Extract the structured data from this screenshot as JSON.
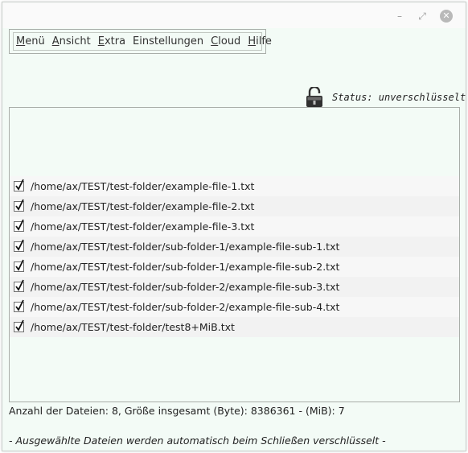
{
  "window": {
    "minimize_icon": "minimize-icon",
    "maximize_icon": "maximize-icon",
    "close_icon": "close-icon"
  },
  "menu": {
    "items": [
      {
        "mnemonic": "M",
        "rest": "enü"
      },
      {
        "mnemonic": "A",
        "rest": "nsicht"
      },
      {
        "mnemonic": "E",
        "rest": "xtra"
      },
      {
        "mnemonic": "",
        "rest": "Einstellungen"
      },
      {
        "mnemonic": "C",
        "rest": "loud"
      },
      {
        "mnemonic": "H",
        "rest": "ilfe"
      }
    ]
  },
  "status": {
    "icon": "unlocked-padlock-icon",
    "text": "Status: unverschlüsselt"
  },
  "files": [
    {
      "checked": true,
      "path": "/home/ax/TEST/test-folder/example-file-1.txt"
    },
    {
      "checked": true,
      "path": "/home/ax/TEST/test-folder/example-file-2.txt"
    },
    {
      "checked": true,
      "path": "/home/ax/TEST/test-folder/example-file-3.txt"
    },
    {
      "checked": true,
      "path": "/home/ax/TEST/test-folder/sub-folder-1/example-file-sub-1.txt"
    },
    {
      "checked": true,
      "path": "/home/ax/TEST/test-folder/sub-folder-1/example-file-sub-2.txt"
    },
    {
      "checked": true,
      "path": "/home/ax/TEST/test-folder/sub-folder-2/example-file-sub-3.txt"
    },
    {
      "checked": true,
      "path": "/home/ax/TEST/test-folder/sub-folder-2/example-file-sub-4.txt"
    },
    {
      "checked": true,
      "path": "/home/ax/TEST/test-folder/test8+MiB.txt"
    }
  ],
  "summary": "Anzahl der Dateien: 8, Größe insgesamt (Byte): 8386361 - (MiB): 7",
  "note": "- Ausgewählte Dateien werden automatisch beim Schließen verschlüsselt -",
  "colors": {
    "background": "#f3fbf6",
    "border": "#a9aea9"
  }
}
